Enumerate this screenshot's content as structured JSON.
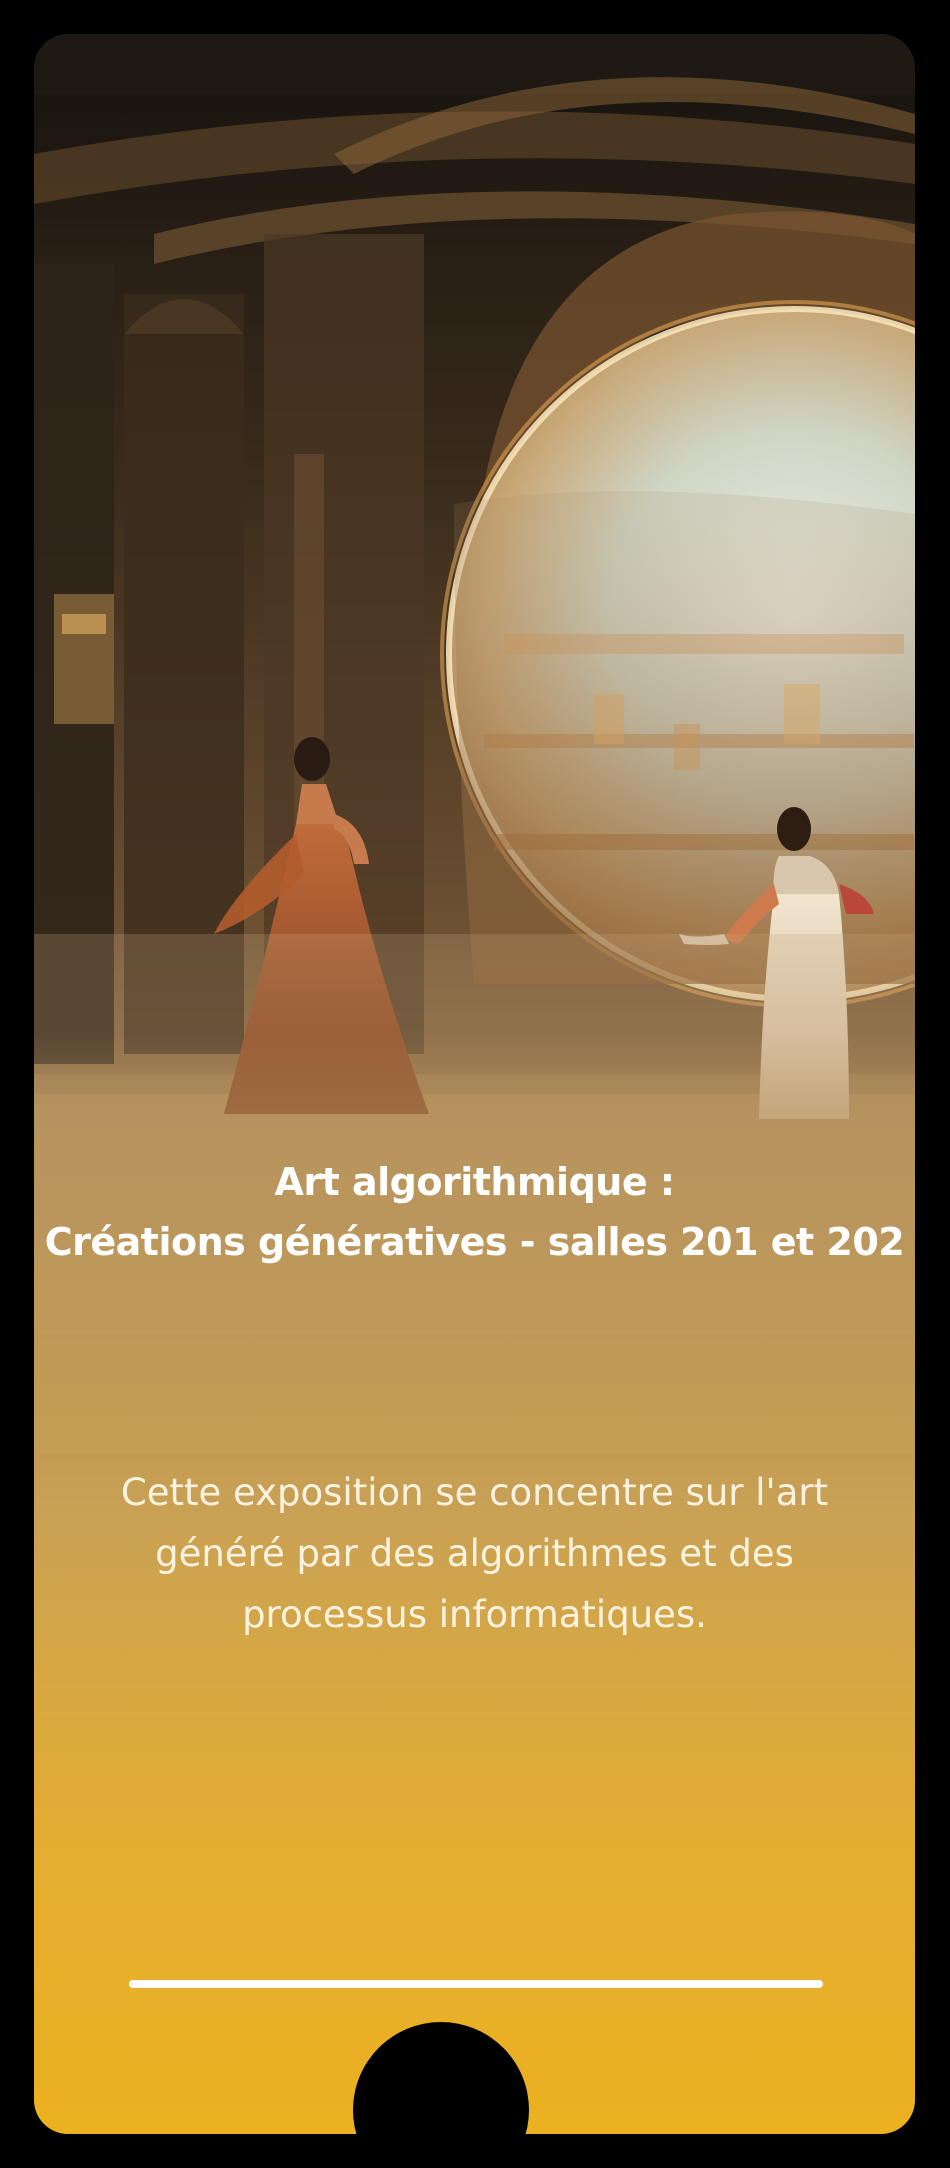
{
  "exhibition": {
    "title_line1": "Art algorithmique :",
    "title_line2": "Créations génératives - salles 201 et 202",
    "description": "Cette exposition se concentre sur l'art généré par des algorithmes et des processus informatiques."
  },
  "artwork": {
    "subject": "painting of two women in gowns inside an ornate hall with a large circular portal"
  },
  "colors": {
    "accent": "#ecb120",
    "background": "#000000",
    "text": "#ffffff"
  }
}
